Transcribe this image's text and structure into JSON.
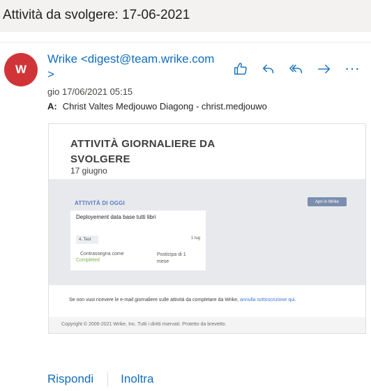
{
  "subject": "Attività da svolgere: 17-06-2021",
  "sender": {
    "initial": "W",
    "display": "Wrike <digest@team.wrike.com>",
    "avatar_color": "#d13438"
  },
  "date": "gio 17/06/2021 05:15",
  "recipients": {
    "label": "A:",
    "value": "Christ Valtes Medjouwo Diagong - christ.medjouwo"
  },
  "actions": [
    "thumbs-up-icon",
    "reply-icon",
    "reply-all-icon",
    "forward-icon",
    "more-icon"
  ],
  "email": {
    "title": "ATTIVITÀ GIORNALIERE DA SVOLGERE",
    "date": "17 giugno",
    "section_label": "ATTIVITÀ DI OGGI",
    "open_button": "Apri in Wrike",
    "task": {
      "name": "Deployement data base tutti libri",
      "tag": "4. Test",
      "due": "1 lug",
      "mark_as": "Contrassegna come",
      "completed": "Completed",
      "postpone": "Posticipa di 1 mese"
    },
    "unsubscribe_text": "Se non vuoi ricevere le e-mail giornaliere sulle attività da completare da Wrike,",
    "unsubscribe_link": "annulla sottoscrizione qui",
    "unsubscribe_end": ".",
    "copyright": "Copyright © 2006-2021 Wrike, Inc. Tutti i diritti riservati. Protetto da brevetto."
  },
  "reply": {
    "reply_label": "Rispondi",
    "forward_label": "Inoltra"
  }
}
